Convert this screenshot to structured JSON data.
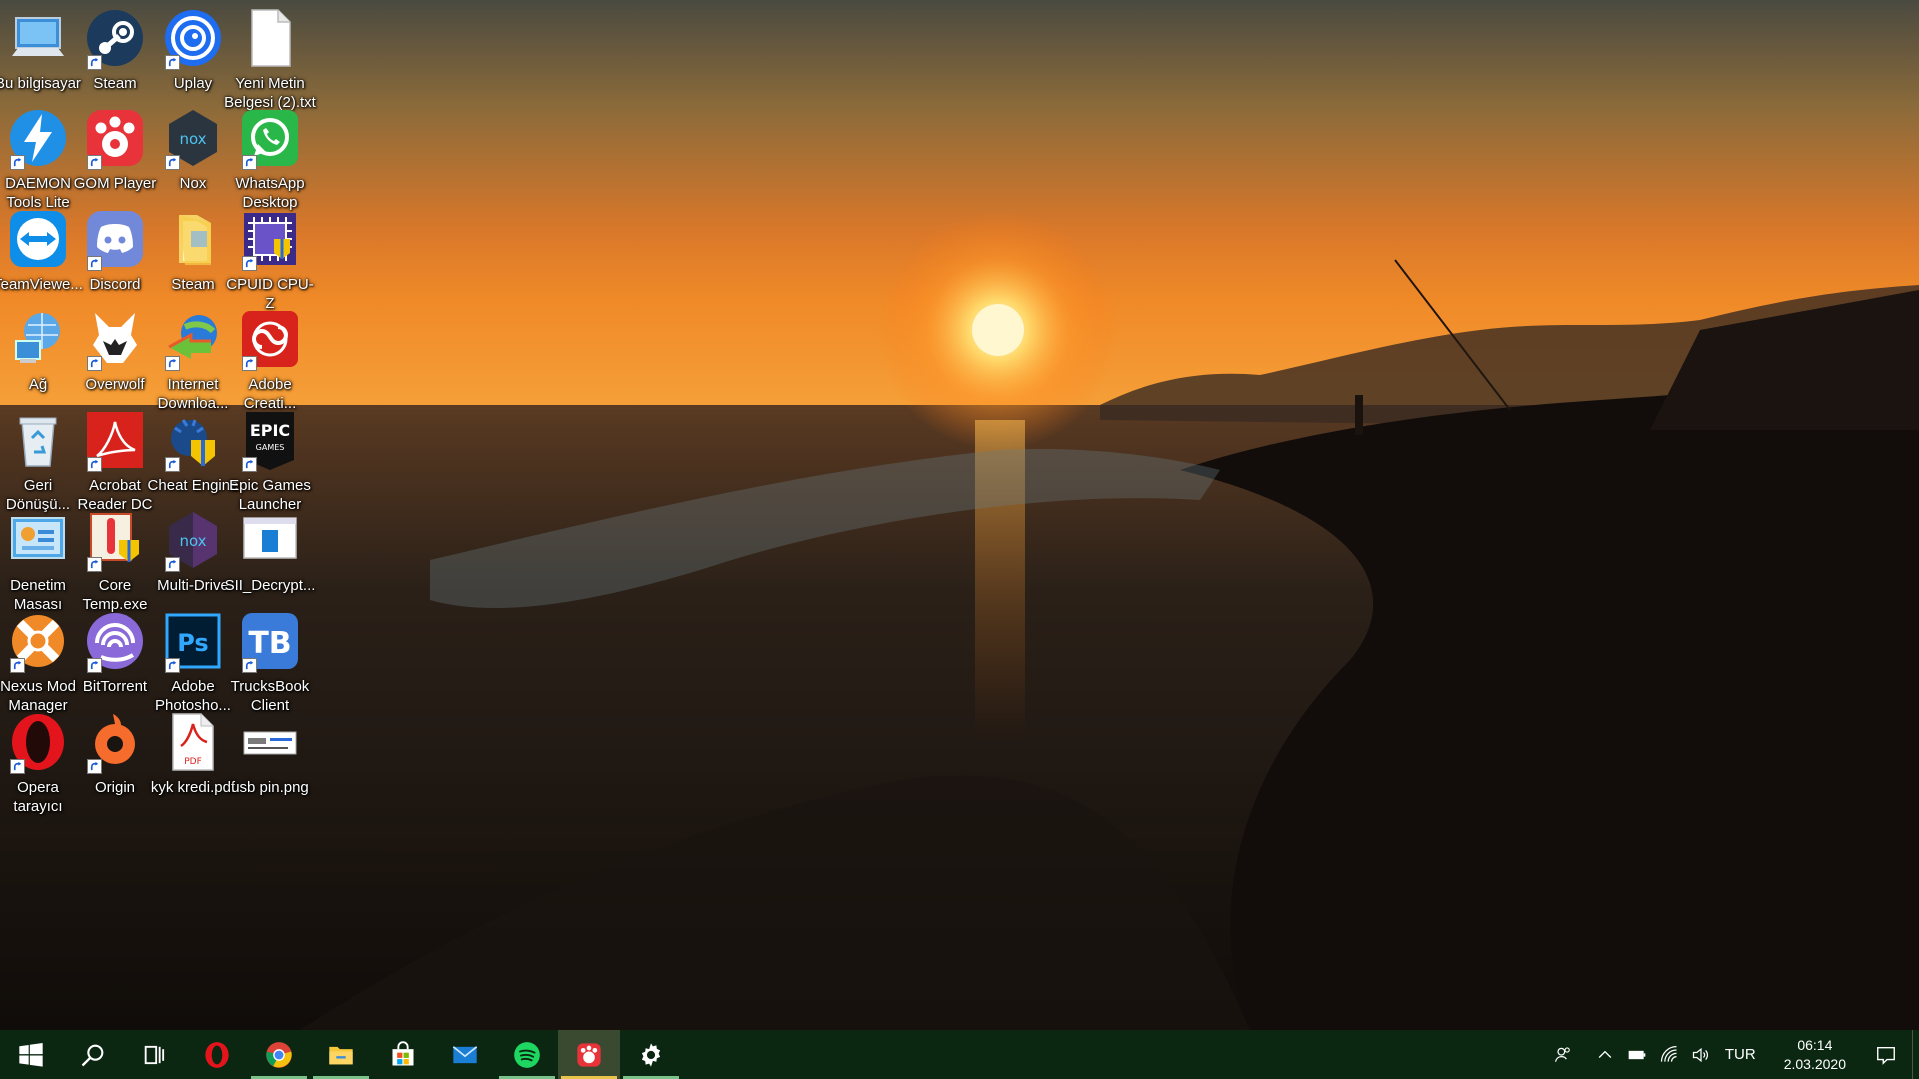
{
  "desktop": {
    "icons": [
      {
        "label": "Bu bilgisayar",
        "icon": "computer-icon",
        "shortcut": false
      },
      {
        "label": "Steam",
        "icon": "steam-icon",
        "shortcut": true
      },
      {
        "label": "Uplay",
        "icon": "uplay-icon",
        "shortcut": true
      },
      {
        "label": "Yeni Metin\nBelgesi (2).txt",
        "icon": "text-file-icon",
        "shortcut": false
      },
      {
        "label": "DAEMON\nTools Lite",
        "icon": "daemon-tools-icon",
        "shortcut": true
      },
      {
        "label": "GOM Player",
        "icon": "gom-player-icon",
        "shortcut": true
      },
      {
        "label": "Nox",
        "icon": "nox-icon",
        "shortcut": true
      },
      {
        "label": "WhatsApp\nDesktop",
        "icon": "whatsapp-icon",
        "shortcut": true
      },
      {
        "label": "TeamViewe...",
        "icon": "teamviewer-icon",
        "shortcut": false
      },
      {
        "label": "Discord",
        "icon": "discord-icon",
        "shortcut": true
      },
      {
        "label": "Steam",
        "icon": "folder-icon",
        "shortcut": false
      },
      {
        "label": "CPUID CPU-Z",
        "icon": "cpuz-icon",
        "shortcut": true
      },
      {
        "label": "Ağ",
        "icon": "network-icon",
        "shortcut": false
      },
      {
        "label": "Overwolf",
        "icon": "overwolf-icon",
        "shortcut": true
      },
      {
        "label": "Internet\nDownloa...",
        "icon": "idm-icon",
        "shortcut": true
      },
      {
        "label": "Adobe\nCreati...",
        "icon": "adobe-cc-icon",
        "shortcut": true
      },
      {
        "label": "Geri\nDönüşü...",
        "icon": "recycle-bin-icon",
        "shortcut": false
      },
      {
        "label": "Acrobat\nReader DC",
        "icon": "acrobat-icon",
        "shortcut": true
      },
      {
        "label": "Cheat Engine",
        "icon": "cheat-engine-icon",
        "shortcut": true
      },
      {
        "label": "Epic Games\nLauncher",
        "icon": "epic-games-icon",
        "shortcut": true
      },
      {
        "label": "Denetim\nMasası",
        "icon": "control-panel-icon",
        "shortcut": false
      },
      {
        "label": "Core\nTemp.exe",
        "icon": "core-temp-icon",
        "shortcut": true
      },
      {
        "label": "Multi-Drive",
        "icon": "nox-multidrive-icon",
        "shortcut": true
      },
      {
        "label": "SII_Decrypt...",
        "icon": "sii-decrypt-icon",
        "shortcut": false
      },
      {
        "label": "Nexus Mod\nManager",
        "icon": "nexus-icon",
        "shortcut": true
      },
      {
        "label": "BitTorrent",
        "icon": "bittorrent-icon",
        "shortcut": true
      },
      {
        "label": "Adobe\nPhotosho...",
        "icon": "photoshop-icon",
        "shortcut": true
      },
      {
        "label": "TrucksBook\nClient",
        "icon": "trucksbook-icon",
        "shortcut": true
      },
      {
        "label": "Opera\ntarayıcı",
        "icon": "opera-icon",
        "shortcut": true
      },
      {
        "label": "Origin",
        "icon": "origin-icon",
        "shortcut": true
      },
      {
        "label": "kyk kredi.pdf",
        "icon": "pdf-file-icon",
        "shortcut": false
      },
      {
        "label": "usb pin.png",
        "icon": "image-file-icon",
        "shortcut": false
      }
    ]
  },
  "taskbar": {
    "buttons": [
      {
        "name": "start-button",
        "icon": "windows-icon"
      },
      {
        "name": "search-button",
        "icon": "search-icon"
      },
      {
        "name": "task-view-button",
        "icon": "task-view-icon"
      },
      {
        "name": "opera-taskbar-button",
        "icon": "opera-icon"
      },
      {
        "name": "chrome-taskbar-button",
        "icon": "chrome-icon"
      },
      {
        "name": "file-explorer-taskbar-button",
        "icon": "folder-icon"
      },
      {
        "name": "store-taskbar-button",
        "icon": "store-icon"
      },
      {
        "name": "mail-taskbar-button",
        "icon": "mail-icon"
      },
      {
        "name": "spotify-taskbar-button",
        "icon": "spotify-icon"
      },
      {
        "name": "gom-taskbar-button",
        "icon": "gom-player-icon"
      },
      {
        "name": "settings-taskbar-button",
        "icon": "gear-icon"
      }
    ],
    "tray": {
      "language": "TUR",
      "time": "06:14",
      "date": "2.03.2020"
    }
  }
}
